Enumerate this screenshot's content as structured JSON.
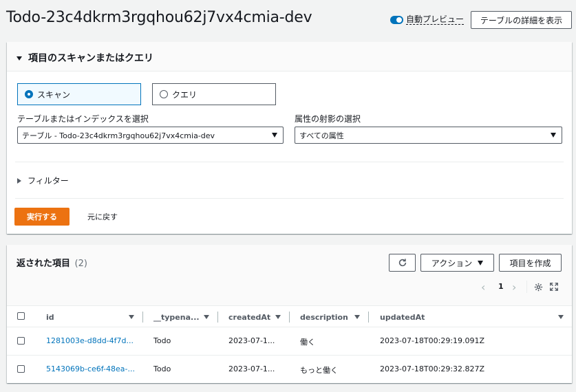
{
  "header": {
    "title": "Todo-23c4dkrm3rgqhou62j7vx4cmia-dev",
    "auto_preview_label": "自動プレビュー",
    "details_button": "テーブルの詳細を表示"
  },
  "scan_panel": {
    "heading": "項目のスキャンまたはクエリ",
    "scan_option": "スキャン",
    "query_option": "クエリ",
    "selected_mode": "スキャン",
    "table_label": "テーブルまたはインデックスを選択",
    "table_value": "テーブル - Todo-23c4dkrm3rgqhou62j7vx4cmia-dev",
    "projection_label": "属性の射影の選択",
    "projection_value": "すべての属性",
    "filter_label": "フィルター",
    "run_button": "実行する",
    "reset_button": "元に戻す"
  },
  "results": {
    "heading": "返された項目",
    "count": "(2)",
    "actions_button": "アクション",
    "create_button": "項目を作成",
    "page_number": "1",
    "columns": [
      "id",
      "__typena...",
      "createdAt",
      "description",
      "updatedAt"
    ],
    "rows": [
      {
        "id": "1281003e-d8dd-4f7d...",
        "typename": "Todo",
        "createdAt": "2023-07-1...",
        "description": "働く",
        "updatedAt": "2023-07-18T00:29:19.091Z"
      },
      {
        "id": "5143069b-ce6f-48ea-...",
        "typename": "Todo",
        "createdAt": "2023-07-1...",
        "description": "もっと働く",
        "updatedAt": "2023-07-18T00:29:32.827Z"
      }
    ]
  },
  "colors": {
    "accent": "#0073bb",
    "primary_button": "#ec7211",
    "background": "#f2f3f3"
  }
}
